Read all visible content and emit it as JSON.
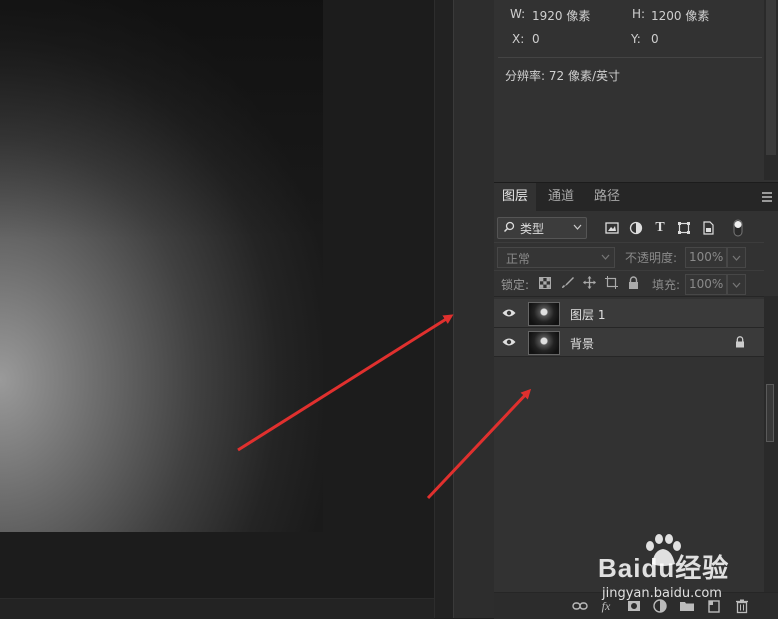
{
  "info": {
    "width_label": "W:",
    "width_value": "1920 像素",
    "height_label": "H:",
    "height_value": "1200 像素",
    "x_label": "X:",
    "x_value": "0",
    "y_label": "Y:",
    "y_value": "0",
    "resolution": "分辨率: 72 像素/英寸"
  },
  "layers_panel": {
    "tabs": [
      "图层",
      "通道",
      "路径"
    ],
    "active_tab": 0,
    "filter_label": "类型",
    "blend_mode": "正常",
    "opacity_label": "不透明度:",
    "opacity_value": "100%",
    "lock_label": "锁定:",
    "fill_label": "填充:",
    "fill_value": "100%",
    "layers": [
      {
        "name": "图层 1",
        "visible": true,
        "locked": false
      },
      {
        "name": "背景",
        "visible": true,
        "locked": true
      }
    ]
  },
  "watermark": {
    "brand": "Baidu经验",
    "url": "jingyan.baidu.com"
  },
  "colors": {
    "panel_bg": "#323232",
    "arrow": "#e0302e"
  }
}
